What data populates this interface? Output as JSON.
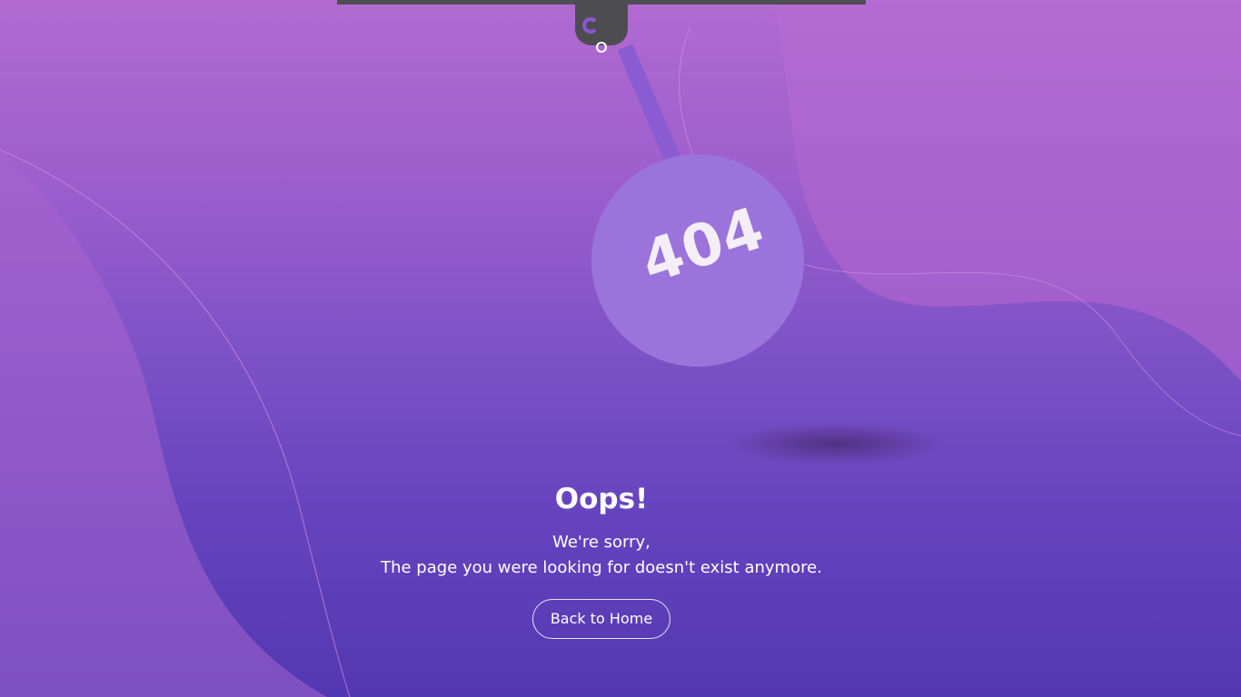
{
  "error_code": "404",
  "headline": "Oops!",
  "message_line1": "We're sorry,",
  "message_line2": "The page you were looking for doesn't exist anymore.",
  "home_button_label": "Back to Home",
  "colors": {
    "gradient_top": "#b26ad2",
    "gradient_bottom": "#5238b2",
    "ball": "#9a74db",
    "hook": "#4d4d51",
    "text": "#ffffff"
  }
}
